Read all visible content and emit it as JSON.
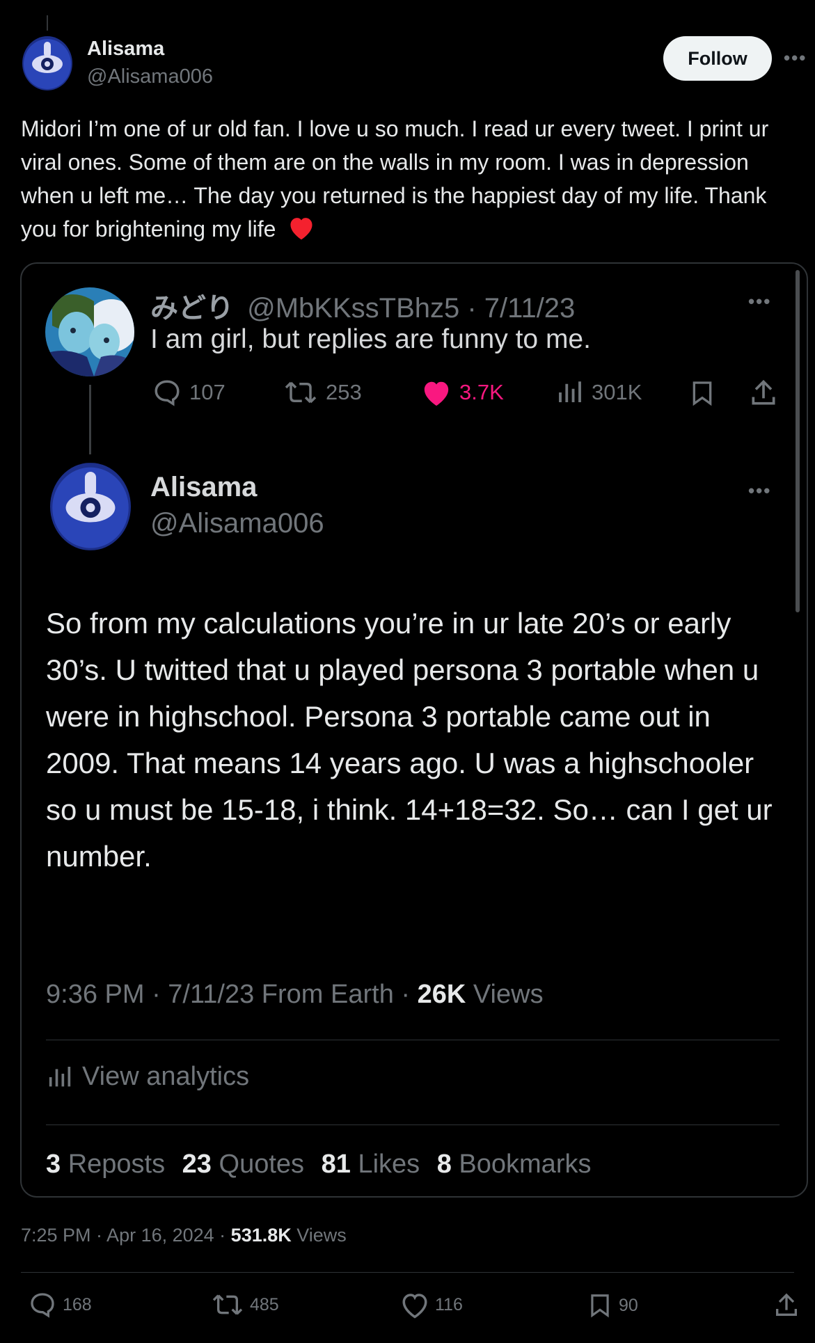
{
  "post": {
    "author_name": "Alisama",
    "author_handle": "@Alisama006",
    "follow_label": "Follow",
    "more_label": "•••",
    "text": "Midori I’m one of ur old fan. I love u so much. I read ur every tweet. I print ur viral ones. Some of them are on the walls in my room. I was in depression when u left me… The day you returned is the happiest day of my life. Thank you for brightening my life",
    "time": "7:25 PM · Apr 16, 2024 · ",
    "views_count": "531.8K",
    "views_label": " Views",
    "replies": "168",
    "reposts": "485",
    "likes": "116",
    "bookmarks": "90"
  },
  "quoted": {
    "original": {
      "name": "みどり",
      "handle_date": "@MbKKssTBhz5 · 7/11/23",
      "text": "I am girl, but replies are funny to me.",
      "replies": "107",
      "reposts": "253",
      "likes": "3.7K",
      "views": "301K",
      "more_label": "•••"
    },
    "reply": {
      "name": "Alisama",
      "handle": "@Alisama006",
      "more_label": "•••",
      "text": "So from my calculations you’re in ur late 20’s or early 30’s. U twitted that u played persona 3 portable when u were in highschool. Persona 3 portable came out in 2009. That means 14 years ago. U was a highschooler so u must be 15-18, i think. 14+18=32. So… can I get ur number.",
      "time": "9:36 PM · 7/11/23 From Earth · ",
      "views_count": "26K",
      "views_label": " Views",
      "analytics_label": "View analytics",
      "reposts_count": "3",
      "reposts_label": " Reposts",
      "quotes_count": "23",
      "quotes_label": " Quotes",
      "likes_count": "81",
      "likes_label": " Likes",
      "bookmarks_count": "8",
      "bookmarks_label": " Bookmarks"
    }
  },
  "colors": {
    "background": "#000000",
    "text": "#e7e9ea",
    "muted": "#71767b",
    "like_pink": "#f91880",
    "heart_red": "#f4212e"
  }
}
